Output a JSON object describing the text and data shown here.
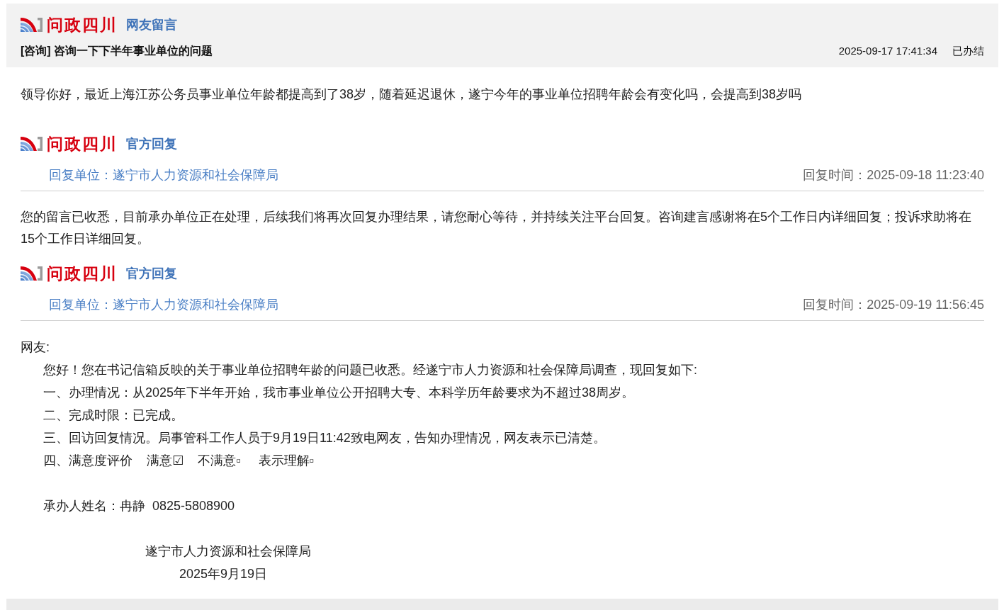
{
  "message": {
    "logo": {
      "brand": "问政四川",
      "section": "网友留言"
    },
    "title": "[咨询] 咨询一下下半年事业单位的问题",
    "date": "2025-09-17 17:41:34",
    "status": "已办结",
    "body": "领导你好，最近上海江苏公务员事业单位年龄都提高到了38岁，随着延迟退休，遂宁今年的事业单位招聘年龄会有变化吗，会提高到38岁吗"
  },
  "replies": [
    {
      "logo": {
        "brand": "问政四川",
        "section": "官方回复"
      },
      "unit": "回复单位：遂宁市人力资源和社会保障局",
      "time": "回复时间：2025-09-18 11:23:40",
      "blocks": [
        {
          "lines": [
            {
              "kind": "paragraph",
              "text": "您的留言已收悉，目前承办单位正在处理，后续我们将再次回复办理结果，请您耐心等待，并持续关注平台回复。咨询建言感谢将在5个工作日内详细回复；投诉求助将在15个工作日详细回复。"
            }
          ]
        }
      ]
    },
    {
      "logo": {
        "brand": "问政四川",
        "section": "官方回复"
      },
      "unit": "回复单位：遂宁市人力资源和社会保障局",
      "time": "回复时间：2025-09-19 11:56:45",
      "blocks": [
        {
          "lines": [
            {
              "kind": "flush",
              "text": "网友:"
            },
            {
              "kind": "indent",
              "text": "您好！您在书记信箱反映的关于事业单位招聘年龄的问题已收悉。经遂宁市人力资源和社会保障局调查，现回复如下:"
            },
            {
              "kind": "indent",
              "text": "一、办理情况：从2025年下半年开始，我市事业单位公开招聘大专、本科学历年龄要求为不超过38周岁。"
            },
            {
              "kind": "indent",
              "text": "二、完成时限：已完成。"
            },
            {
              "kind": "indent",
              "text": "三、回访回复情况。局事管科工作人员于9月19日11:42致电网友，告知办理情况，网友表示已清楚。"
            },
            {
              "kind": "indent",
              "text": "四、满意度评价    满意☑    不满意▫     表示理解▫"
            }
          ]
        },
        {
          "lines": [
            {
              "kind": "indent",
              "text": "承办人姓名：冉静  0825-5808900"
            }
          ]
        },
        {
          "lines": [
            {
              "kind": "signature",
              "text": "遂宁市人力资源和社会保障局"
            },
            {
              "kind": "date",
              "text": "2025年9月19日"
            }
          ]
        }
      ]
    }
  ]
}
